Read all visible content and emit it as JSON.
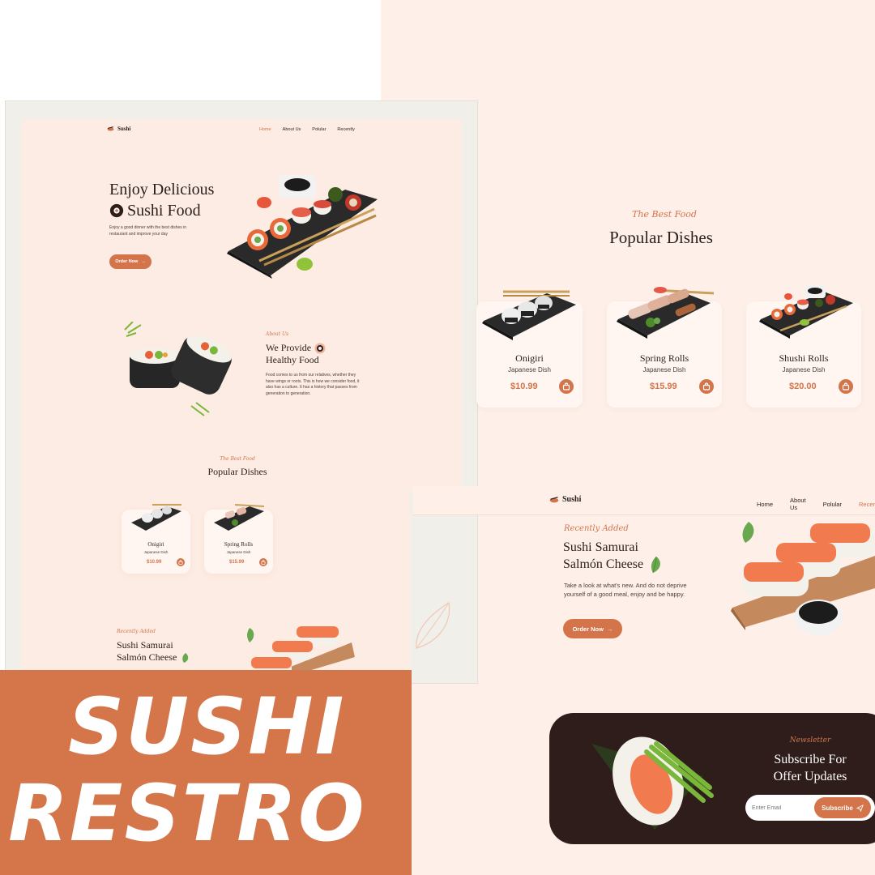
{
  "colors": {
    "accent": "#d4764a",
    "peach": "#fdece3",
    "dark": "#2e1d1a"
  },
  "brand": "Sushi",
  "nav": {
    "home": "Home",
    "about": "About Us",
    "popular": "Polular",
    "recently": "Recently"
  },
  "hero": {
    "line1": "Enjoy Delicious",
    "line2": "Sushi Food",
    "desc": "Enjoy a good dinner with the best dishes in restaurant and improve your day",
    "cta": "Order Now"
  },
  "about": {
    "tag": "About Us",
    "line1": "We Provide",
    "line2": "Healthy Food",
    "desc": "Food comes to us from our relatives, whether they have wings or roots. This is how we consider food, it also has a culture. It has a history that passes from generation to generation."
  },
  "popular": {
    "tag": "The Best Food",
    "title": "Popular Dishes",
    "items": [
      {
        "name": "Onigiri",
        "sub": "Japanese Dish",
        "price": "$10.99"
      },
      {
        "name": "Spring Rolls",
        "sub": "Japanese Dish",
        "price": "$15.99"
      },
      {
        "name": "Shushi Rolls",
        "sub": "Japanese Dish",
        "price": "$20.00"
      }
    ]
  },
  "recent": {
    "tag": "Recently Added",
    "line1": "Sushi Samurai",
    "line2": "Salmón Cheese",
    "desc": "Take a look at what's new. And do not deprive yourself of a good meal, enjoy and be happy.",
    "cta": "Order Now"
  },
  "newsletter": {
    "tag": "Newsletter",
    "line1": "Subscribe For",
    "line2": "Offer Updates",
    "placeholder": "Enter Email",
    "button": "Subscribe"
  },
  "banner": {
    "line1": "SUSHI",
    "line2": "RESTRO"
  }
}
